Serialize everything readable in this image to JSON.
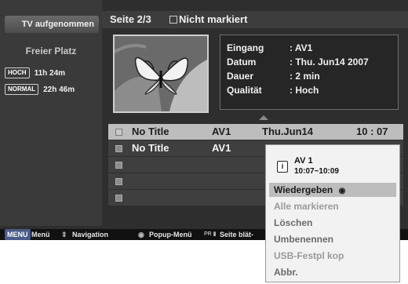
{
  "left_panel": {
    "tab_label": "TV aufgenommen",
    "free_space_label": "Freier Platz",
    "quality_rows": [
      {
        "tag": "HOCH",
        "time": "11h 24m"
      },
      {
        "tag": "NORMAL",
        "time": "22h 46m"
      }
    ]
  },
  "header": {
    "page": "Seite 2/3",
    "mark_label": "Nicht  markiert"
  },
  "info": {
    "rows": [
      {
        "key": "Eingang",
        "value": ": AV1"
      },
      {
        "key": "Datum",
        "value": ": Thu.  Jun14 2007"
      },
      {
        "key": "Dauer",
        "value": ": 2 min"
      },
      {
        "key": "Qualität",
        "value": ": Hoch"
      }
    ]
  },
  "list": {
    "rows": [
      {
        "title": "No Title",
        "input": "AV1",
        "date": "Thu.Jun14",
        "time": "10 : 07",
        "selected": true
      },
      {
        "title": "No Title",
        "input": "AV1",
        "date": "",
        "time": "",
        "selected": false
      },
      {
        "title": "",
        "input": "",
        "date": "",
        "time": "",
        "selected": false
      },
      {
        "title": "",
        "input": "",
        "date": "",
        "time": "",
        "selected": false
      },
      {
        "title": "",
        "input": "",
        "date": "",
        "time": "",
        "selected": false
      }
    ]
  },
  "bottom_bar": {
    "menu_key": "MENU",
    "menu_label": "Menü",
    "nav_label": "Navigation",
    "popup_label": "Popup-Menü",
    "page_label": "Seite blät-"
  },
  "popup": {
    "channel": "AV 1",
    "time_range": "10:07~10:09",
    "info_icon": "i",
    "items": [
      {
        "label": "Wiedergeben",
        "state": "active"
      },
      {
        "label": "Alle markieren",
        "state": "dim"
      },
      {
        "label": "Löschen",
        "state": "norm"
      },
      {
        "label": "Umbenennen",
        "state": "norm"
      },
      {
        "label": "USB-Festpl kop",
        "state": "dim"
      },
      {
        "label": "Abbr.",
        "state": "norm"
      }
    ]
  }
}
